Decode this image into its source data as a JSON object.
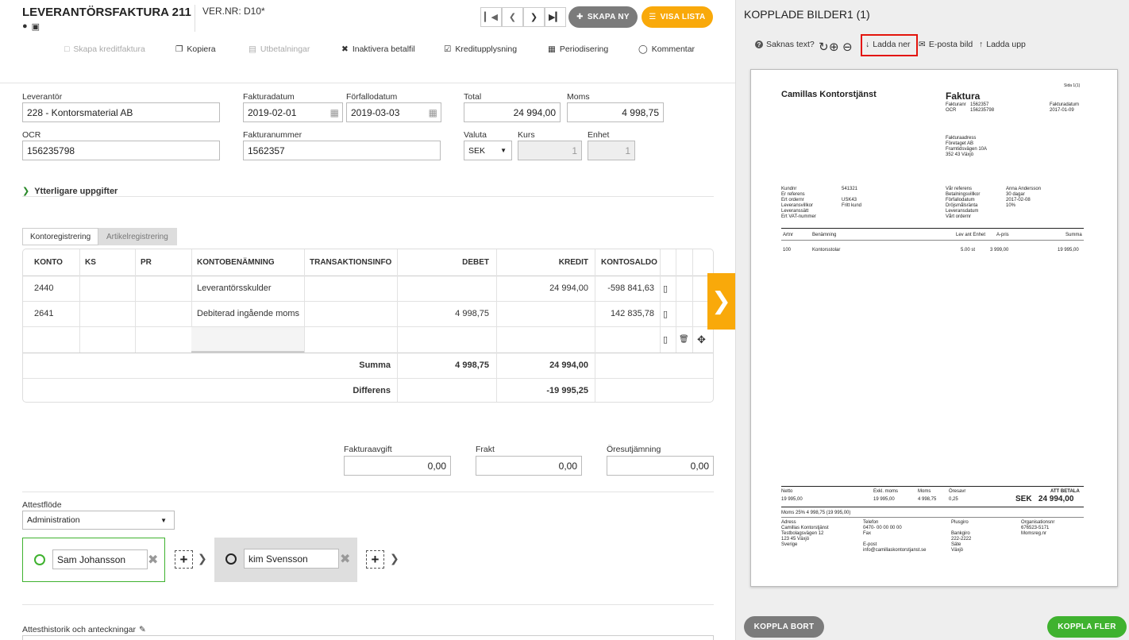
{
  "header": {
    "title": "LEVERANTÖRSFAKTURA 211",
    "ver": "VER.NR: D10*",
    "skapa_ny": "SKAPA NY",
    "visa_lista": "VISA LISTA"
  },
  "toolbar": {
    "kreditfaktura": "Skapa kreditfaktura",
    "kopiera": "Kopiera",
    "utbetalningar": "Utbetalningar",
    "inaktivera": "Inaktivera betalfil",
    "kreditupplysning": "Kreditupplysning",
    "periodisering": "Periodisering",
    "kommentar": "Kommentar"
  },
  "form": {
    "leverantor_label": "Leverantör",
    "leverantor": "228 - Kontorsmaterial AB",
    "fakturadatum_label": "Fakturadatum",
    "fakturadatum": "2019-02-01",
    "forfallodatum_label": "Förfallodatum",
    "forfallodatum": "2019-03-03",
    "total_label": "Total",
    "total": "24 994,00",
    "moms_label": "Moms",
    "moms": "4 998,75",
    "ocr_label": "OCR",
    "ocr": "156235798",
    "fakturanummer_label": "Fakturanummer",
    "fakturanummer": "1562357",
    "valuta_label": "Valuta",
    "valuta": "SEK",
    "kurs_label": "Kurs",
    "kurs": "1",
    "enhet_label": "Enhet",
    "enhet": "1",
    "ytterligare": "Ytterligare uppgifter"
  },
  "tabs": {
    "konto": "Kontoregistrering",
    "artikel": "Artikelregistrering"
  },
  "grid": {
    "headers": {
      "konto": "KONTO",
      "ks": "KS",
      "pr": "PR",
      "kontobenamning": "KONTOBENÄMNING",
      "transaktionsinfo": "TRANSAKTIONSINFO",
      "debet": "DEBET",
      "kredit": "KREDIT",
      "kontosaldo": "KONTOSALDO"
    },
    "rows": [
      {
        "konto": "2440",
        "namn": "Leverantörsskulder",
        "debet": "",
        "kredit": "24 994,00",
        "saldo": "-598 841,63"
      },
      {
        "konto": "2641",
        "namn": "Debiterad ingående moms",
        "debet": "4 998,75",
        "kredit": "",
        "saldo": "142 835,78"
      }
    ],
    "summa_label": "Summa",
    "summa_debet": "4 998,75",
    "summa_kredit": "24 994,00",
    "differens_label": "Differens",
    "differens_kredit": "-19 995,25"
  },
  "fees": {
    "fakturaavgift_label": "Fakturaavgift",
    "fakturaavgift": "0,00",
    "frakt_label": "Frakt",
    "frakt": "0,00",
    "oresutjamning_label": "Öresutjämning",
    "oresutjamning": "0,00"
  },
  "attest": {
    "label": "Attestflöde",
    "flow": "Administration",
    "person1": "Sam Johansson",
    "person2": "kim Svensson",
    "historik": "Attesthistorik och anteckningar"
  },
  "right": {
    "title": "KOPPLADE BILDER1 (1)",
    "saknas": "Saknas text?",
    "ladda_ner": "Ladda ner",
    "eposta": "E-posta bild",
    "ladda_upp": "Ladda upp",
    "koppla_bort": "KOPPLA BORT",
    "koppla_fler": "KOPPLA FLER"
  },
  "invoice": {
    "sida": "Sida 1(1)",
    "company": "Camillas Kontorstjänst",
    "faktura": "Faktura",
    "fakturanr_l": "Fakturanr",
    "fakturanr": "1562357",
    "ocr_l": "OCR",
    "ocr": "156235798",
    "fakturadatum_l": "Fakturadatum",
    "fakturadatum": "2017-01-09",
    "adress": [
      "Fakturaadress",
      "Företaget AB",
      "Framtidsvägen 10A",
      "352 43 Växjö"
    ],
    "left_labels": [
      "Kundnr",
      "Er referens",
      "Ert ordernr",
      "Leveransvillkor",
      "Leveranssätt",
      "Ert VAT-nummer"
    ],
    "left_values": [
      "541321",
      "",
      "USK43",
      "Fritt kund",
      "",
      ""
    ],
    "right_labels": [
      "Vår referens",
      "Betalningsvillkor",
      "Förfallodatum",
      "Dröjsmålsränta",
      "Leveransdatum",
      "Vårt ordernr"
    ],
    "right_values": [
      "Anna Andersson",
      "30 dagar",
      "2017-02-08",
      "10%",
      "",
      ""
    ],
    "col_artnr": "Artnr",
    "col_ben": "Benämning",
    "col_lev": "Lev ant Enhet",
    "col_apris": "A-pris",
    "col_summa": "Summa",
    "row_artnr": "100",
    "row_ben": "Kontorsstolar",
    "row_lev": "5.00 st",
    "row_apris": "3 999,00",
    "row_summa": "19 995,00",
    "netto_l": "Netto",
    "netto": "19 995,00",
    "exkl_l": "Exkl. moms",
    "exkl": "19 995,00",
    "moms_l": "Moms",
    "moms": "4 998,75",
    "oresavr_l": "Öresavr",
    "oresavr": "0,25",
    "att_betala_l": "ATT BETALA",
    "att_betala": "SEK   24 994,00",
    "momsrad": "Moms 25% 4 998,75 (19 995,00)",
    "f_adress": [
      "Adress",
      "Camillas Kontorstjänst",
      "Testbolagsvägen 12",
      "123 45 Växjö",
      "Sverige"
    ],
    "f_telefon": [
      "Telefon",
      "0470- 00 00 00 00",
      "Fax",
      "",
      "E-post",
      "info@camillaskontorstjanst.se"
    ],
    "f_plus": [
      "Plusgiro",
      "",
      "Bankgiro",
      "222-2222",
      "Säte",
      "Växjö"
    ],
    "f_org": [
      "Organisationsnr",
      "676523-5171",
      "Momsreg.nr"
    ]
  },
  "colors": {
    "orange": "#f9a90a",
    "grey_pill": "#7b7b7b",
    "green": "#3fb22f",
    "red_highlight": "#e3140c"
  }
}
